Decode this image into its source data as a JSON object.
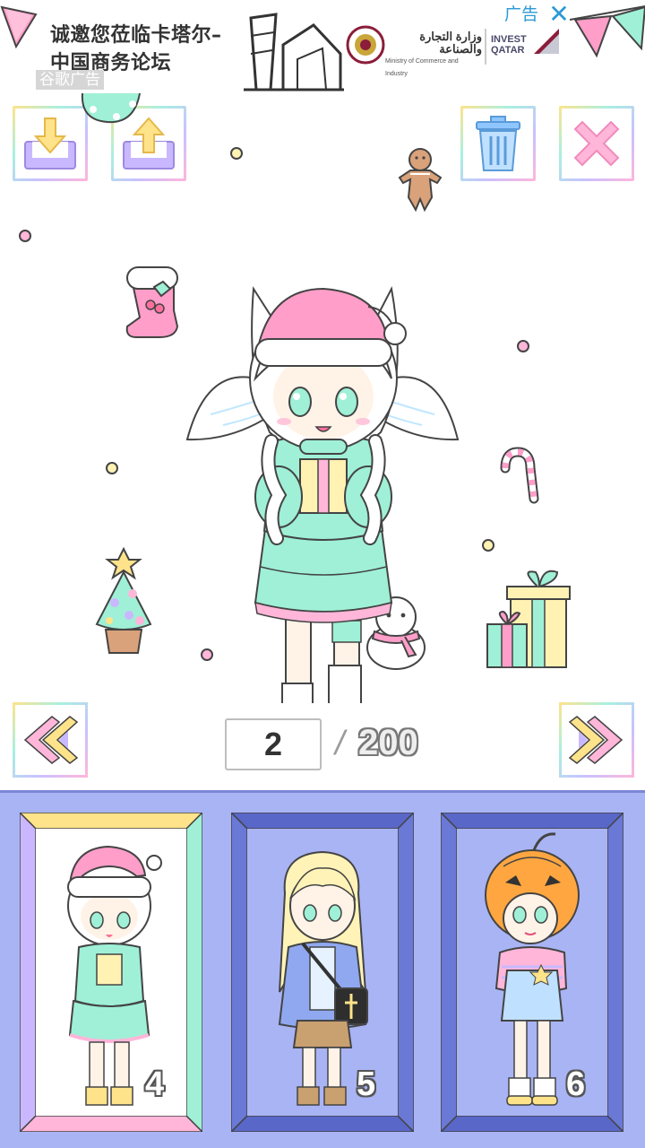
{
  "ad": {
    "headline": "诚邀您莅临卡塔尔–中国商务论坛",
    "watermark": "谷歌广告",
    "label": "广告",
    "close": "✕",
    "ministry_name": "وزارة التجارة والصناعة",
    "ministry_sub": "Ministry of Commerce and Industry",
    "invest_brand": "INVEST QATAR"
  },
  "toolbar": {
    "download_icon": "download-icon",
    "upload_icon": "upload-icon",
    "delete_icon": "trash-icon",
    "close_icon": "close-icon"
  },
  "pager": {
    "current_page": "2",
    "separator": "/",
    "total_pages": "200"
  },
  "slots": [
    {
      "number": "4",
      "frame": "pastel-rainbow",
      "theme": "christmas"
    },
    {
      "number": "5",
      "frame": "blue",
      "theme": "jacket"
    },
    {
      "number": "6",
      "frame": "blue",
      "theme": "pumpkin"
    }
  ],
  "colors": {
    "panel_bg": "#a9b4f4",
    "mint": "#9ff0d6",
    "pink": "#ff9ec9",
    "lavender": "#c9b8ff",
    "yellow": "#ffe38a"
  }
}
